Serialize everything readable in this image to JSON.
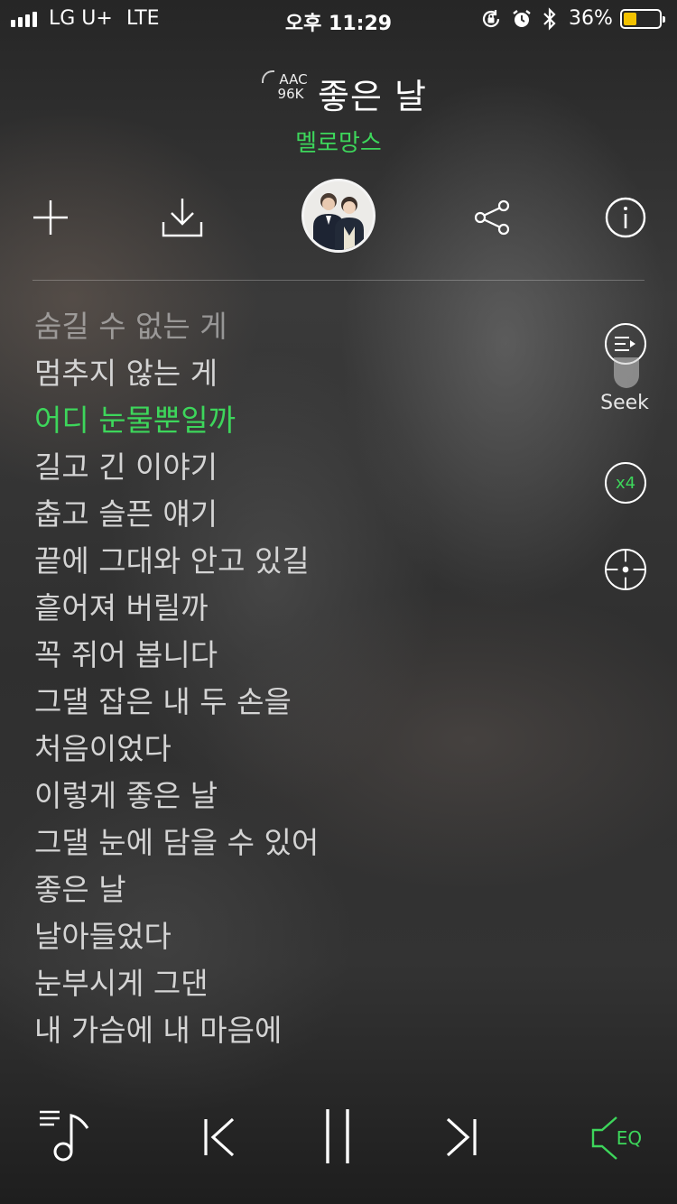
{
  "status_bar": {
    "carrier": "LG U+",
    "network": "LTE",
    "time": "오후 11:29",
    "battery_percent": "36%",
    "battery_level": 0.36,
    "icons": [
      "orientation-lock-icon",
      "alarm-icon",
      "bluetooth-icon"
    ]
  },
  "header": {
    "quality_codec": "AAC",
    "quality_bitrate": "96K",
    "title": "좋은 날",
    "artist": "멜로망스"
  },
  "toolbar": {
    "icons": [
      "add-icon",
      "download-icon",
      "share-icon",
      "info-icon"
    ]
  },
  "lyrics": [
    {
      "text": "숨길 수 없는 게",
      "state": "faded"
    },
    {
      "text": "멈추지 않는 게",
      "state": "normal"
    },
    {
      "text": "어디 눈물뿐일까",
      "state": "current"
    },
    {
      "text": "길고 긴 이야기",
      "state": "normal"
    },
    {
      "text": "춥고 슬픈 얘기",
      "state": "normal"
    },
    {
      "text": "끝에 그대와 안고 있길",
      "state": "normal"
    },
    {
      "text": "흩어져 버릴까",
      "state": "normal"
    },
    {
      "text": "꼭 쥐어 봅니다",
      "state": "normal"
    },
    {
      "text": "그댈 잡은 내 두 손을",
      "state": "normal"
    },
    {
      "text": "처음이었다",
      "state": "normal"
    },
    {
      "text": "이렇게 좋은 날",
      "state": "normal"
    },
    {
      "text": "그댈 눈에 담을 수 있어",
      "state": "normal"
    },
    {
      "text": "좋은 날",
      "state": "normal"
    },
    {
      "text": "날아들었다",
      "state": "normal"
    },
    {
      "text": "눈부시게 그댄",
      "state": "normal"
    },
    {
      "text": "내 가슴에 내 마음에",
      "state": "normal"
    }
  ],
  "side_controls": {
    "seek_label": "Seek",
    "speed_label": "x4"
  },
  "player": {
    "eq_label": "EQ",
    "accent_color": "#3dd65b",
    "icons": [
      "playlist-icon",
      "previous-icon",
      "pause-icon",
      "next-icon",
      "eq-speaker-icon"
    ]
  }
}
